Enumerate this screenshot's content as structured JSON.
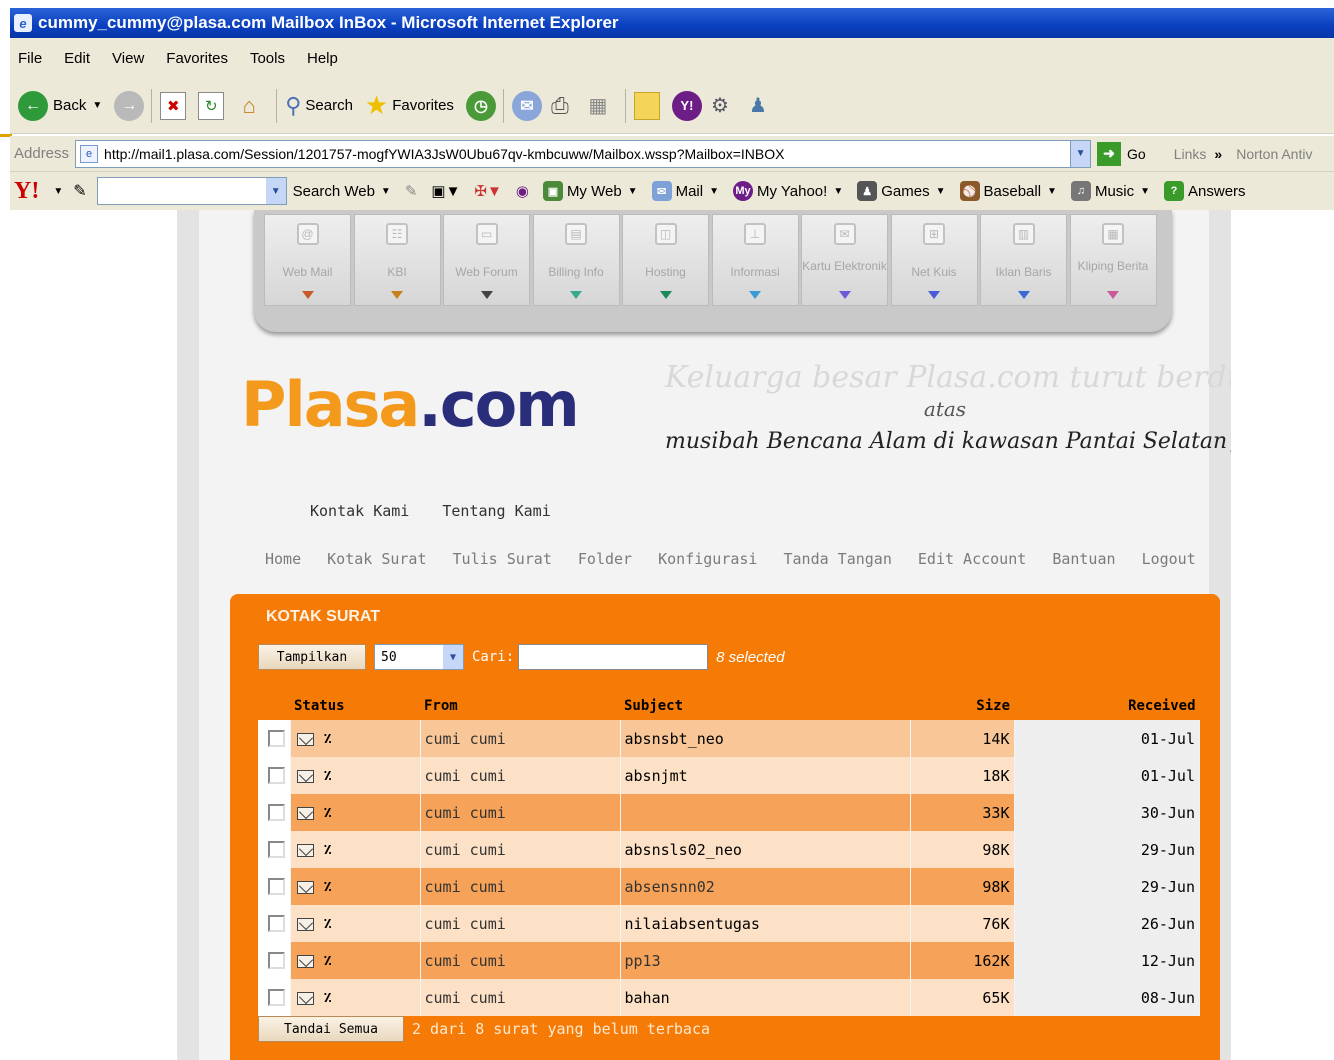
{
  "window": {
    "title": "cummy_cummy@plasa.com Mailbox InBox - Microsoft Internet Explorer"
  },
  "menu": [
    "File",
    "Edit",
    "View",
    "Favorites",
    "Tools",
    "Help"
  ],
  "toolbar": {
    "back": "Back",
    "search": "Search",
    "favorites": "Favorites"
  },
  "address": {
    "label": "Address",
    "url": "http://mail1.plasa.com/Session/1201757-mogfYWIA3JsW0Ubu67qv-kmbcuww/Mailbox.wssp?Mailbox=INBOX",
    "go": "Go",
    "links": "Links",
    "norton": "Norton Antiv"
  },
  "yahoo": {
    "search_web": "Search Web",
    "my_web": "My Web",
    "mail": "Mail",
    "my_yahoo": "My Yahoo!",
    "games": "Games",
    "baseball": "Baseball",
    "music": "Music",
    "answers": "Answers"
  },
  "portal_nav": [
    {
      "label": "Web Mail",
      "icon": "@"
    },
    {
      "label": "KBI",
      "icon": "☷"
    },
    {
      "label": "Web Forum",
      "icon": "▭"
    },
    {
      "label": "Billing Info",
      "icon": "▤"
    },
    {
      "label": "Hosting",
      "icon": "◫"
    },
    {
      "label": "Informasi",
      "icon": "⊥"
    },
    {
      "label": "Kartu Elektronik",
      "icon": "✉"
    },
    {
      "label": "Net Kuis",
      "icon": "⊞"
    },
    {
      "label": "Iklan Baris",
      "icon": "▥"
    },
    {
      "label": "Kliping Berita",
      "icon": "▦"
    }
  ],
  "brand": {
    "logo_a": "Plasa",
    "logo_b": ".com"
  },
  "condolence": {
    "line1": "Keluarga besar Plasa.com turut berduka atas",
    "line2": "atas",
    "line3": "musibah Bencana Alam di kawasan Pantai Selatan Jawa"
  },
  "top_links": [
    "Kontak Kami",
    "Tentang Kami"
  ],
  "main_nav": [
    "Home",
    "Kotak Surat",
    "Tulis Surat",
    "Folder",
    "Konfigurasi",
    "Tanda Tangan",
    "Edit Account",
    "Bantuan",
    "Logout"
  ],
  "mailbox": {
    "header": "KOTAK SURAT",
    "show_button": "Tampilkan",
    "page_size": "50",
    "search_label": "Cari:",
    "search_value": "",
    "selected_text": "8 selected",
    "columns": {
      "status": "Status",
      "from": "From",
      "subject": "Subject",
      "size": "Size",
      "received": "Received"
    },
    "messages": [
      {
        "from": "cumi cumi",
        "subject": "absnsbt_neo",
        "size": "14K",
        "received": "01-Jul",
        "read": true
      },
      {
        "from": "cumi cumi",
        "subject": "absnjmt",
        "size": "18K",
        "received": "01-Jul",
        "read": true
      },
      {
        "from": "cumi cumi",
        "subject": "",
        "size": "33K",
        "received": "30-Jun",
        "read": true
      },
      {
        "from": "cumi cumi",
        "subject": "absnsls02_neo",
        "size": "98K",
        "received": "29-Jun",
        "read": true
      },
      {
        "from": "cumi cumi",
        "subject": "absensnn02",
        "size": "98K",
        "received": "29-Jun",
        "read": false
      },
      {
        "from": "cumi cumi",
        "subject": "nilaiabsentugas",
        "size": "76K",
        "received": "26-Jun",
        "read": true
      },
      {
        "from": "cumi cumi",
        "subject": "pp13",
        "size": "162K",
        "received": "12-Jun",
        "read": true
      },
      {
        "from": "cumi cumi",
        "subject": "bahan",
        "size": "65K",
        "received": "08-Jun",
        "read": false
      }
    ],
    "mark_all_button": "Tandai Semua",
    "unread_status": "2 dari 8 surat yang belum terbaca"
  },
  "colors": {
    "panel": "#f57a06",
    "title_bar": "#0a3fbf",
    "logo_orange": "#f39a1c",
    "logo_navy": "#2a2e7a"
  }
}
